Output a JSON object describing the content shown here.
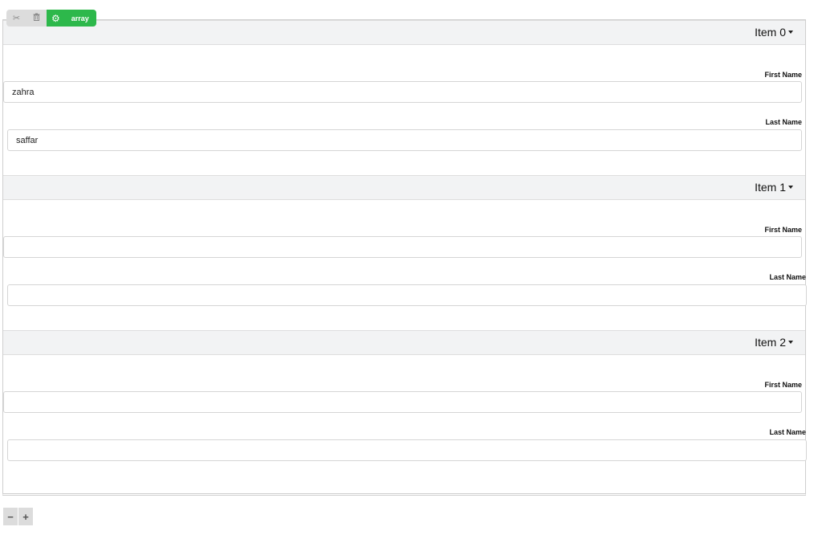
{
  "toolbar": {
    "icons": [
      "scissors-icon",
      "trash-icon",
      "gear-icon"
    ],
    "scissors_glyph": "✂",
    "trash_glyph": "🗑",
    "gear_glyph": "⚙",
    "type_label": "array",
    "accent_color": "#2db84b"
  },
  "items": [
    {
      "title": "Item 0",
      "first_name_label": "First Name",
      "first_name_value": "zahra",
      "last_name_label": "Last Name",
      "last_name_value": "saffar"
    },
    {
      "title": "Item 1",
      "first_name_label": "First Name",
      "first_name_value": "",
      "last_name_label": "Last Name",
      "last_name_value": ""
    },
    {
      "title": "Item 2",
      "first_name_label": "First Name",
      "first_name_value": "",
      "last_name_label": "Last Name",
      "last_name_value": ""
    }
  ],
  "controls": {
    "remove_label": "−",
    "add_label": "+"
  }
}
